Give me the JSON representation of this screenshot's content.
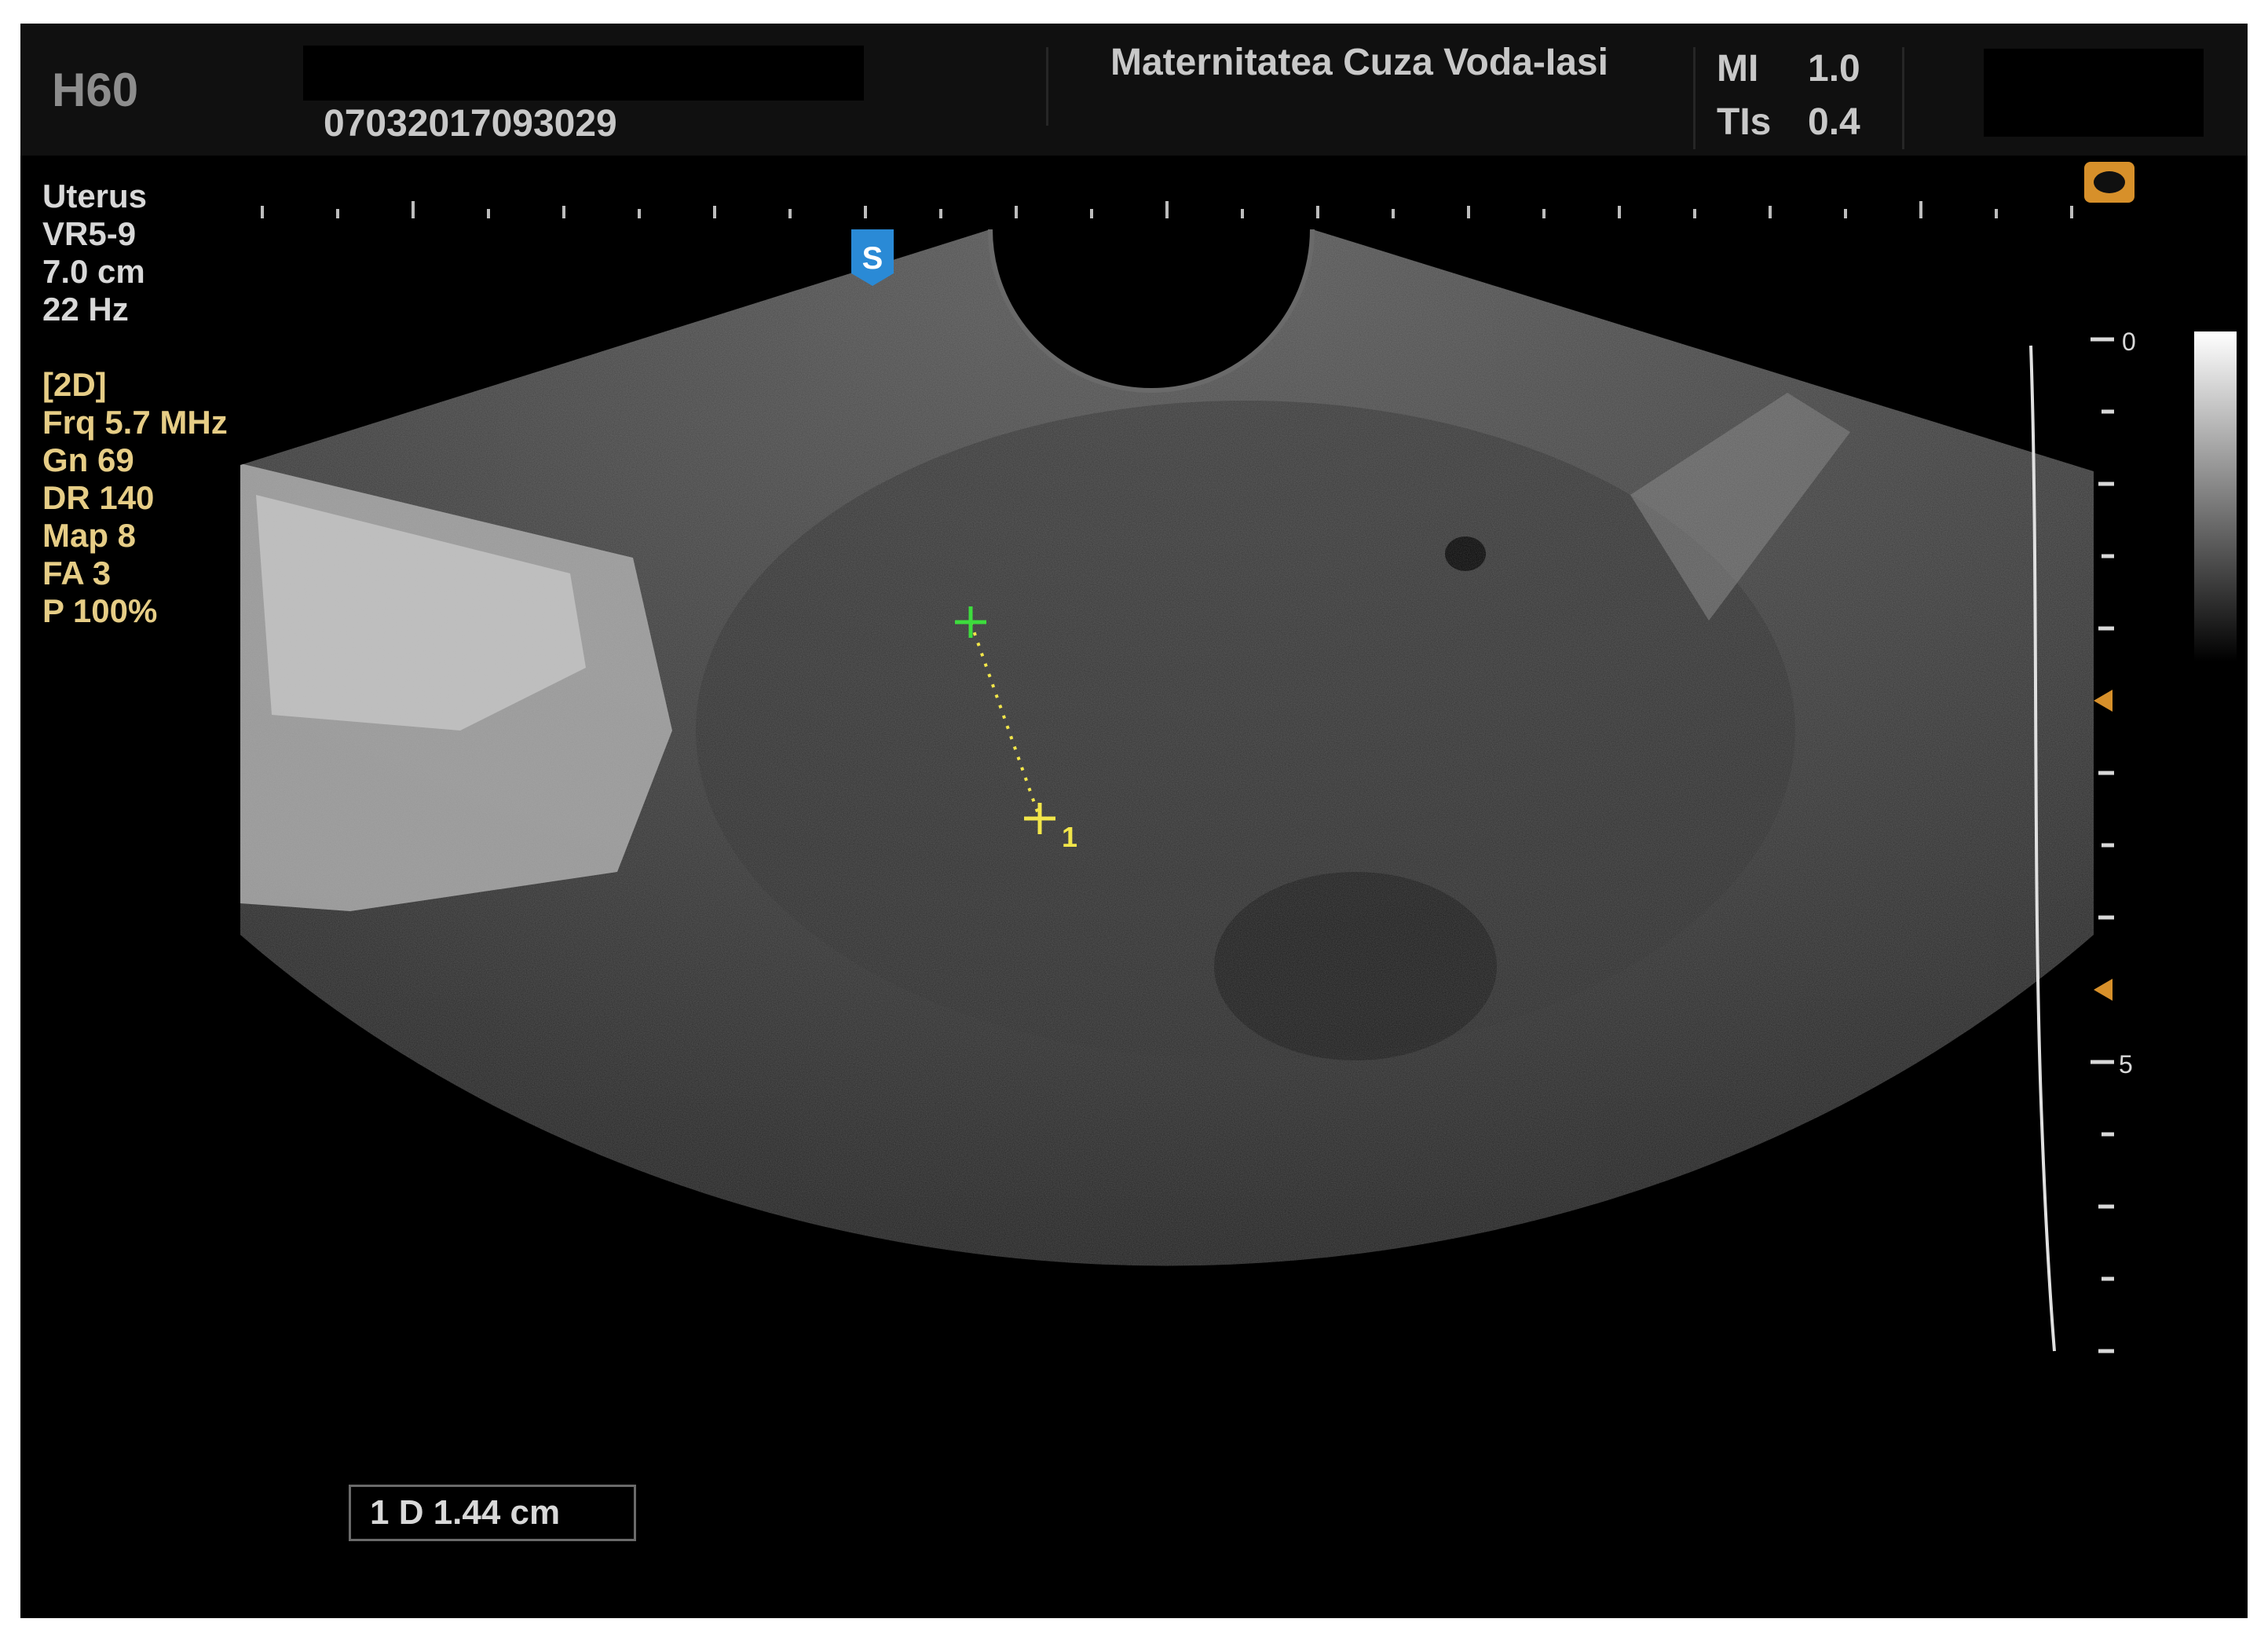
{
  "header": {
    "model": "H60",
    "exam_id": "07032017093029",
    "hospital": "Maternitatea Cuza Voda-Iasi",
    "mi_label": "MI",
    "mi_value": "1.0",
    "tis_label": "TIs",
    "tis_value": "0.4"
  },
  "probe_params": [
    "Uterus",
    "VR5-9",
    "7.0 cm",
    "22 Hz"
  ],
  "imaging_params": [
    "[2D]",
    "Frq  5.7 MHz",
    "Gn  69",
    "DR  140",
    "Map 8",
    "FA  3",
    "P     100%"
  ],
  "depth_scale": {
    "labels": [
      "0",
      "5"
    ]
  },
  "markers": {
    "steer_label": "S",
    "caliper_label": "1"
  },
  "measurement": {
    "text": "1  D  1.44 cm"
  },
  "colors": {
    "background": "#000000",
    "header": "#101010",
    "text": "#d8d8d8",
    "param_text": "#e6cd86",
    "caliper_start": "#3ddc3d",
    "caliper_end": "#f2e64a",
    "steer_marker": "#2a8ad6"
  },
  "icons": [
    "steer-marker-icon",
    "probe-orientation-icon",
    "focus-marker-icon"
  ]
}
